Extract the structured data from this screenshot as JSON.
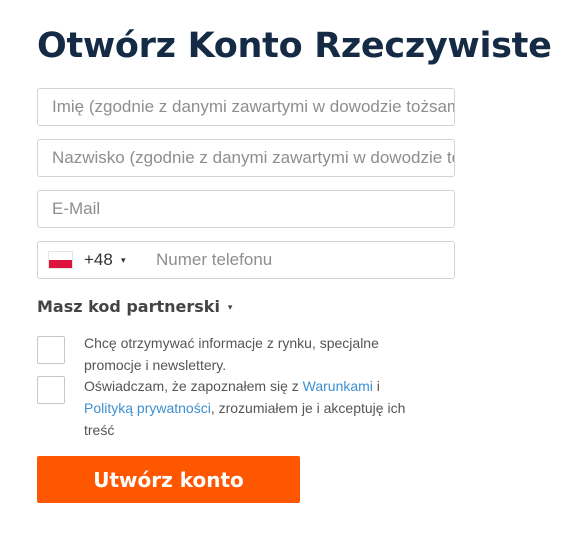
{
  "form": {
    "title": "Otwórz Konto Rzeczywiste",
    "first_name_placeholder": "Imię (zgodnie z danymi zawartymi w dowodzie tożsamości)",
    "last_name_placeholder": "Nazwisko (zgodnie z danymi zawartymi w dowodzie tożsamości)",
    "email_placeholder": "E-Mail",
    "phone": {
      "flag_icon": "poland-flag-icon",
      "dial_code": "+48",
      "dial_caret": "▾",
      "placeholder": "Numer telefonu"
    },
    "partner_code": {
      "label": "Masz kod partnerski",
      "caret": "▾"
    },
    "newsletter_text": "Chcę otrzymywać informacje z rynku, specjalne promocje i newslettery.",
    "terms": {
      "prefix": "Oświadczam, że zapoznałem się z ",
      "terms_link": "Warunkami",
      "connector": " i ",
      "privacy_link": "Polityką prywatności",
      "suffix": ", zrozumiałem je i akceptuję ich treść"
    },
    "submit_label": "Utwórz konto"
  },
  "colors": {
    "title": "#152a44",
    "submit_bg": "#ff5700",
    "link": "#3c8fd1",
    "flag_white": "#ffffff",
    "flag_red": "#dc143c"
  }
}
